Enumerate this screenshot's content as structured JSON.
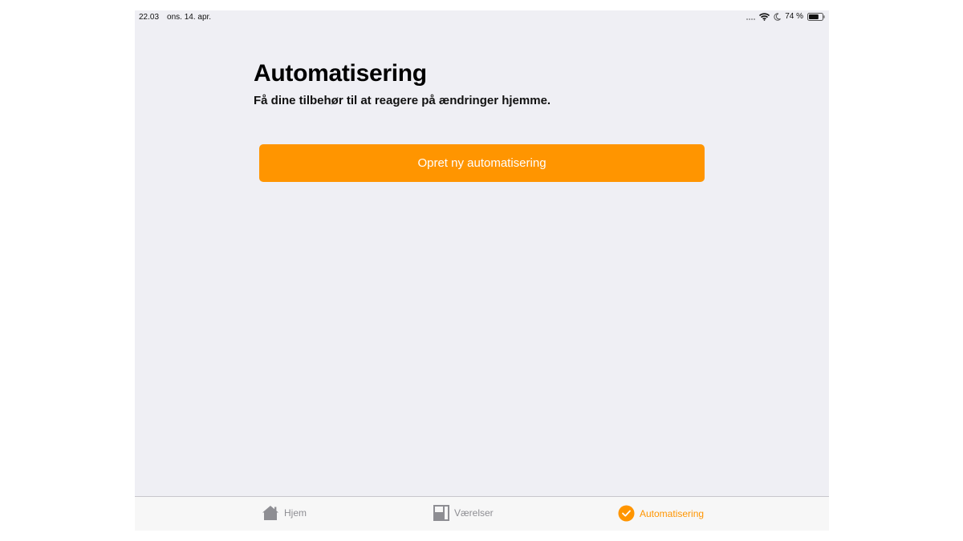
{
  "status_bar": {
    "time": "22.03",
    "date": "ons. 14. apr.",
    "battery_percent": "74 %",
    "battery_level": 0.74,
    "icons": [
      "signal-icon",
      "wifi-icon",
      "moon-icon",
      "battery-icon"
    ]
  },
  "main": {
    "title": "Automatisering",
    "subtitle": "Få dine tilbehør til at reagere på ændringer hjemme.",
    "create_button_label": "Opret ny automatisering"
  },
  "tab_bar": {
    "tabs": [
      {
        "label": "Hjem",
        "icon": "house-icon",
        "active": false
      },
      {
        "label": "Værelser",
        "icon": "rooms-icon",
        "active": false
      },
      {
        "label": "Automatisering",
        "icon": "automation-clock-icon",
        "active": true
      }
    ]
  },
  "colors": {
    "accent": "#ff9500",
    "background": "#efeff4",
    "tab_inactive": "#8e8e93"
  }
}
